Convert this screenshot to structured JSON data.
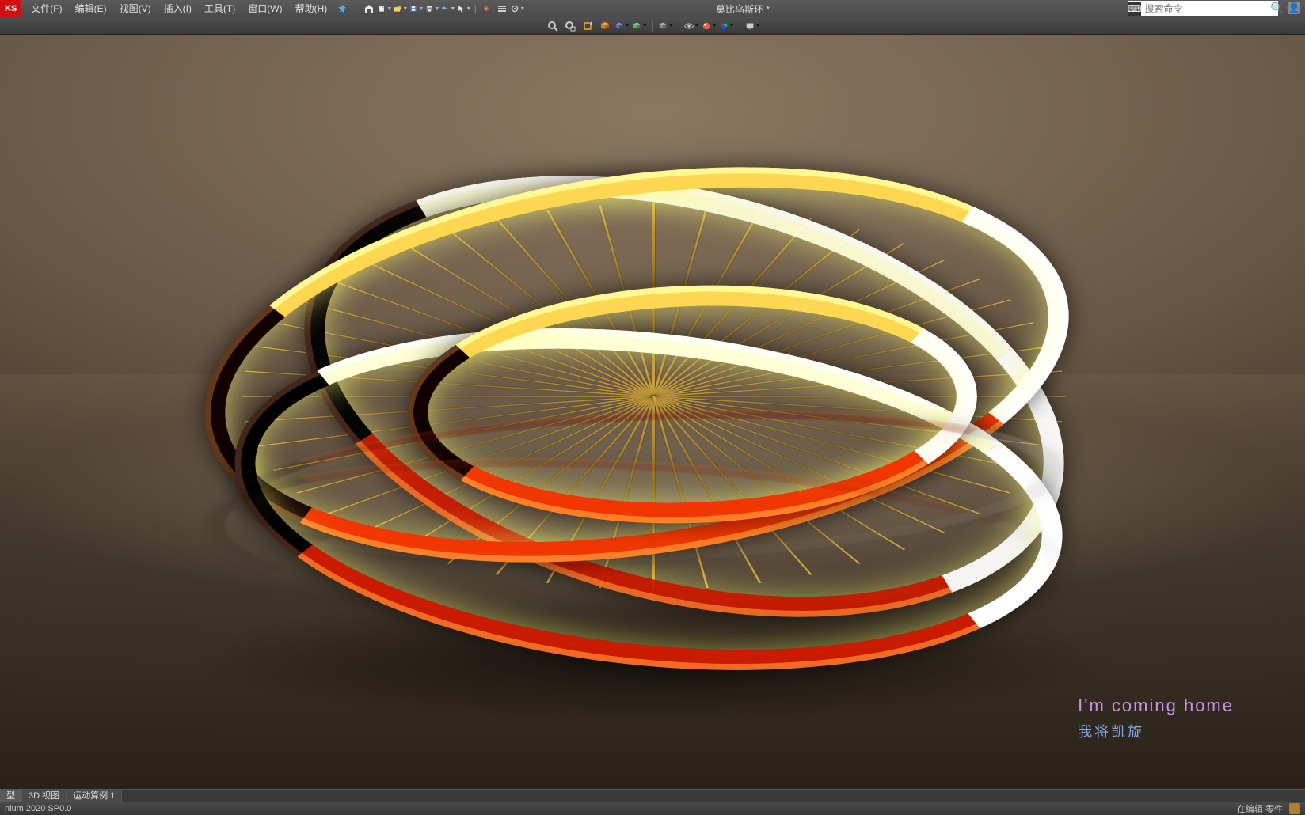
{
  "logo": "KS",
  "menus": [
    {
      "label": "文件(F)"
    },
    {
      "label": "编辑(E)"
    },
    {
      "label": "视图(V)"
    },
    {
      "label": "插入(I)"
    },
    {
      "label": "工具(T)"
    },
    {
      "label": "窗口(W)"
    },
    {
      "label": "帮助(H)"
    }
  ],
  "qat_icons": [
    "home-icon",
    "new-icon",
    "open-icon",
    "save-icon",
    "print-icon",
    "undo-icon",
    "select-icon",
    "rebuild-icon",
    "options-icon",
    "settings-icon"
  ],
  "doc_title": "莫比乌斯环 *",
  "search": {
    "placeholder": "搜索命令"
  },
  "subbar_icons": [
    "zoom-fit-icon",
    "zoom-area-icon",
    "prev-view-icon",
    "section-icon",
    "view-orient-icon",
    "display-style-icon",
    "hide-show-icon",
    "edit-appearance-icon",
    "apply-scene-icon",
    "view-settings-icon",
    "render-icon"
  ],
  "caption": {
    "en": "I'm coming home",
    "zh": "我将凯旋"
  },
  "tabs": [
    {
      "label": "型"
    },
    {
      "label": "3D 视图"
    },
    {
      "label": "运动算例 1"
    }
  ],
  "status": {
    "left": "nium 2020 SP0.0",
    "right": "在编辑 零件"
  }
}
